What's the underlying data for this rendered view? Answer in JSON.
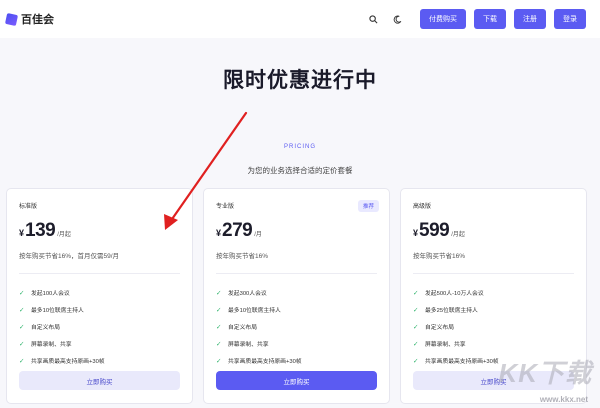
{
  "header": {
    "brand_name": "百佳会",
    "buttons": [
      "付费购买",
      "下载",
      "注册",
      "登录"
    ]
  },
  "hero": {
    "title": "限时优惠进行中"
  },
  "pricing": {
    "tag": "PRICING",
    "subtitle": "为您的业务选择合适的定价套餐",
    "plans": [
      {
        "name": "标准版",
        "badge": "",
        "currency": "¥",
        "price": "139",
        "unit": "/月起",
        "note": "按年购买节省16%，首月仅需59/月",
        "features": [
          "发起100人会议",
          "最多10位联席主持人",
          "自定义布局",
          "屏幕录制、共享",
          "共享画质最高支持原画+30帧"
        ],
        "button": "立即购买",
        "highlight": false
      },
      {
        "name": "专业版",
        "badge": "推荐",
        "currency": "¥",
        "price": "279",
        "unit": "/月",
        "note": "按年购买节省16%",
        "features": [
          "发起300人会议",
          "最多10位联席主持人",
          "自定义布局",
          "屏幕录制、共享",
          "共享画质最高支持原画+30帧"
        ],
        "button": "立即购买",
        "highlight": true
      },
      {
        "name": "高级版",
        "badge": "",
        "currency": "¥",
        "price": "599",
        "unit": "/月起",
        "note": "按年购买节省16%",
        "features": [
          "发起500人-10万人会议",
          "最多25位联席主持人",
          "自定义布局",
          "屏幕录制、共享",
          "共享画质最高支持原画+30帧"
        ],
        "button": "立即购买",
        "highlight": false
      }
    ]
  },
  "watermark": {
    "text": "KK下载",
    "url": "www.kkx.net"
  },
  "colors": {
    "accent": "#5b5bf2",
    "check": "#2fb36b",
    "arrow": "#e02020"
  },
  "icons": [
    "search-icon",
    "moon-icon",
    "check-icon",
    "arrow-annotation"
  ]
}
